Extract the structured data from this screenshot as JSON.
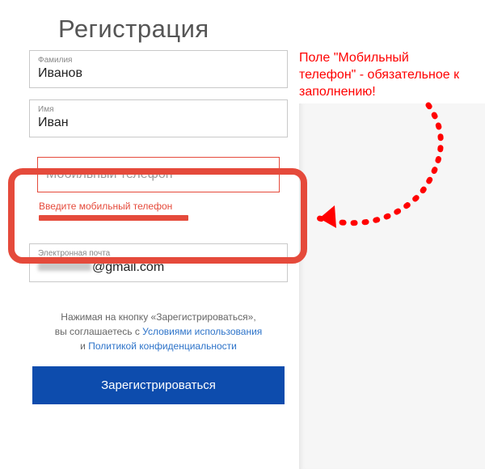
{
  "title": "Регистрация",
  "fields": {
    "surname": {
      "label": "Фамилия",
      "value": "Иванов"
    },
    "name": {
      "label": "Имя",
      "value": "Иван"
    },
    "phone": {
      "placeholder": "Мобильный телефон",
      "value": "",
      "error": "Введите мобильный телефон"
    },
    "email": {
      "label": "Электронная почта",
      "suffix": "@gmail.com"
    }
  },
  "consent": {
    "line1_prefix": "Нажимая на кнопку «Зарегистрироваться»,",
    "line2_prefix": "вы соглашаетесь с ",
    "terms": "Условиями использования",
    "and": " и ",
    "privacy": "Политикой конфиденциальности"
  },
  "submit": "Зарегистрироваться",
  "annotation": "Поле \"Мобильный телефон\" - обязательное к заполнению!"
}
